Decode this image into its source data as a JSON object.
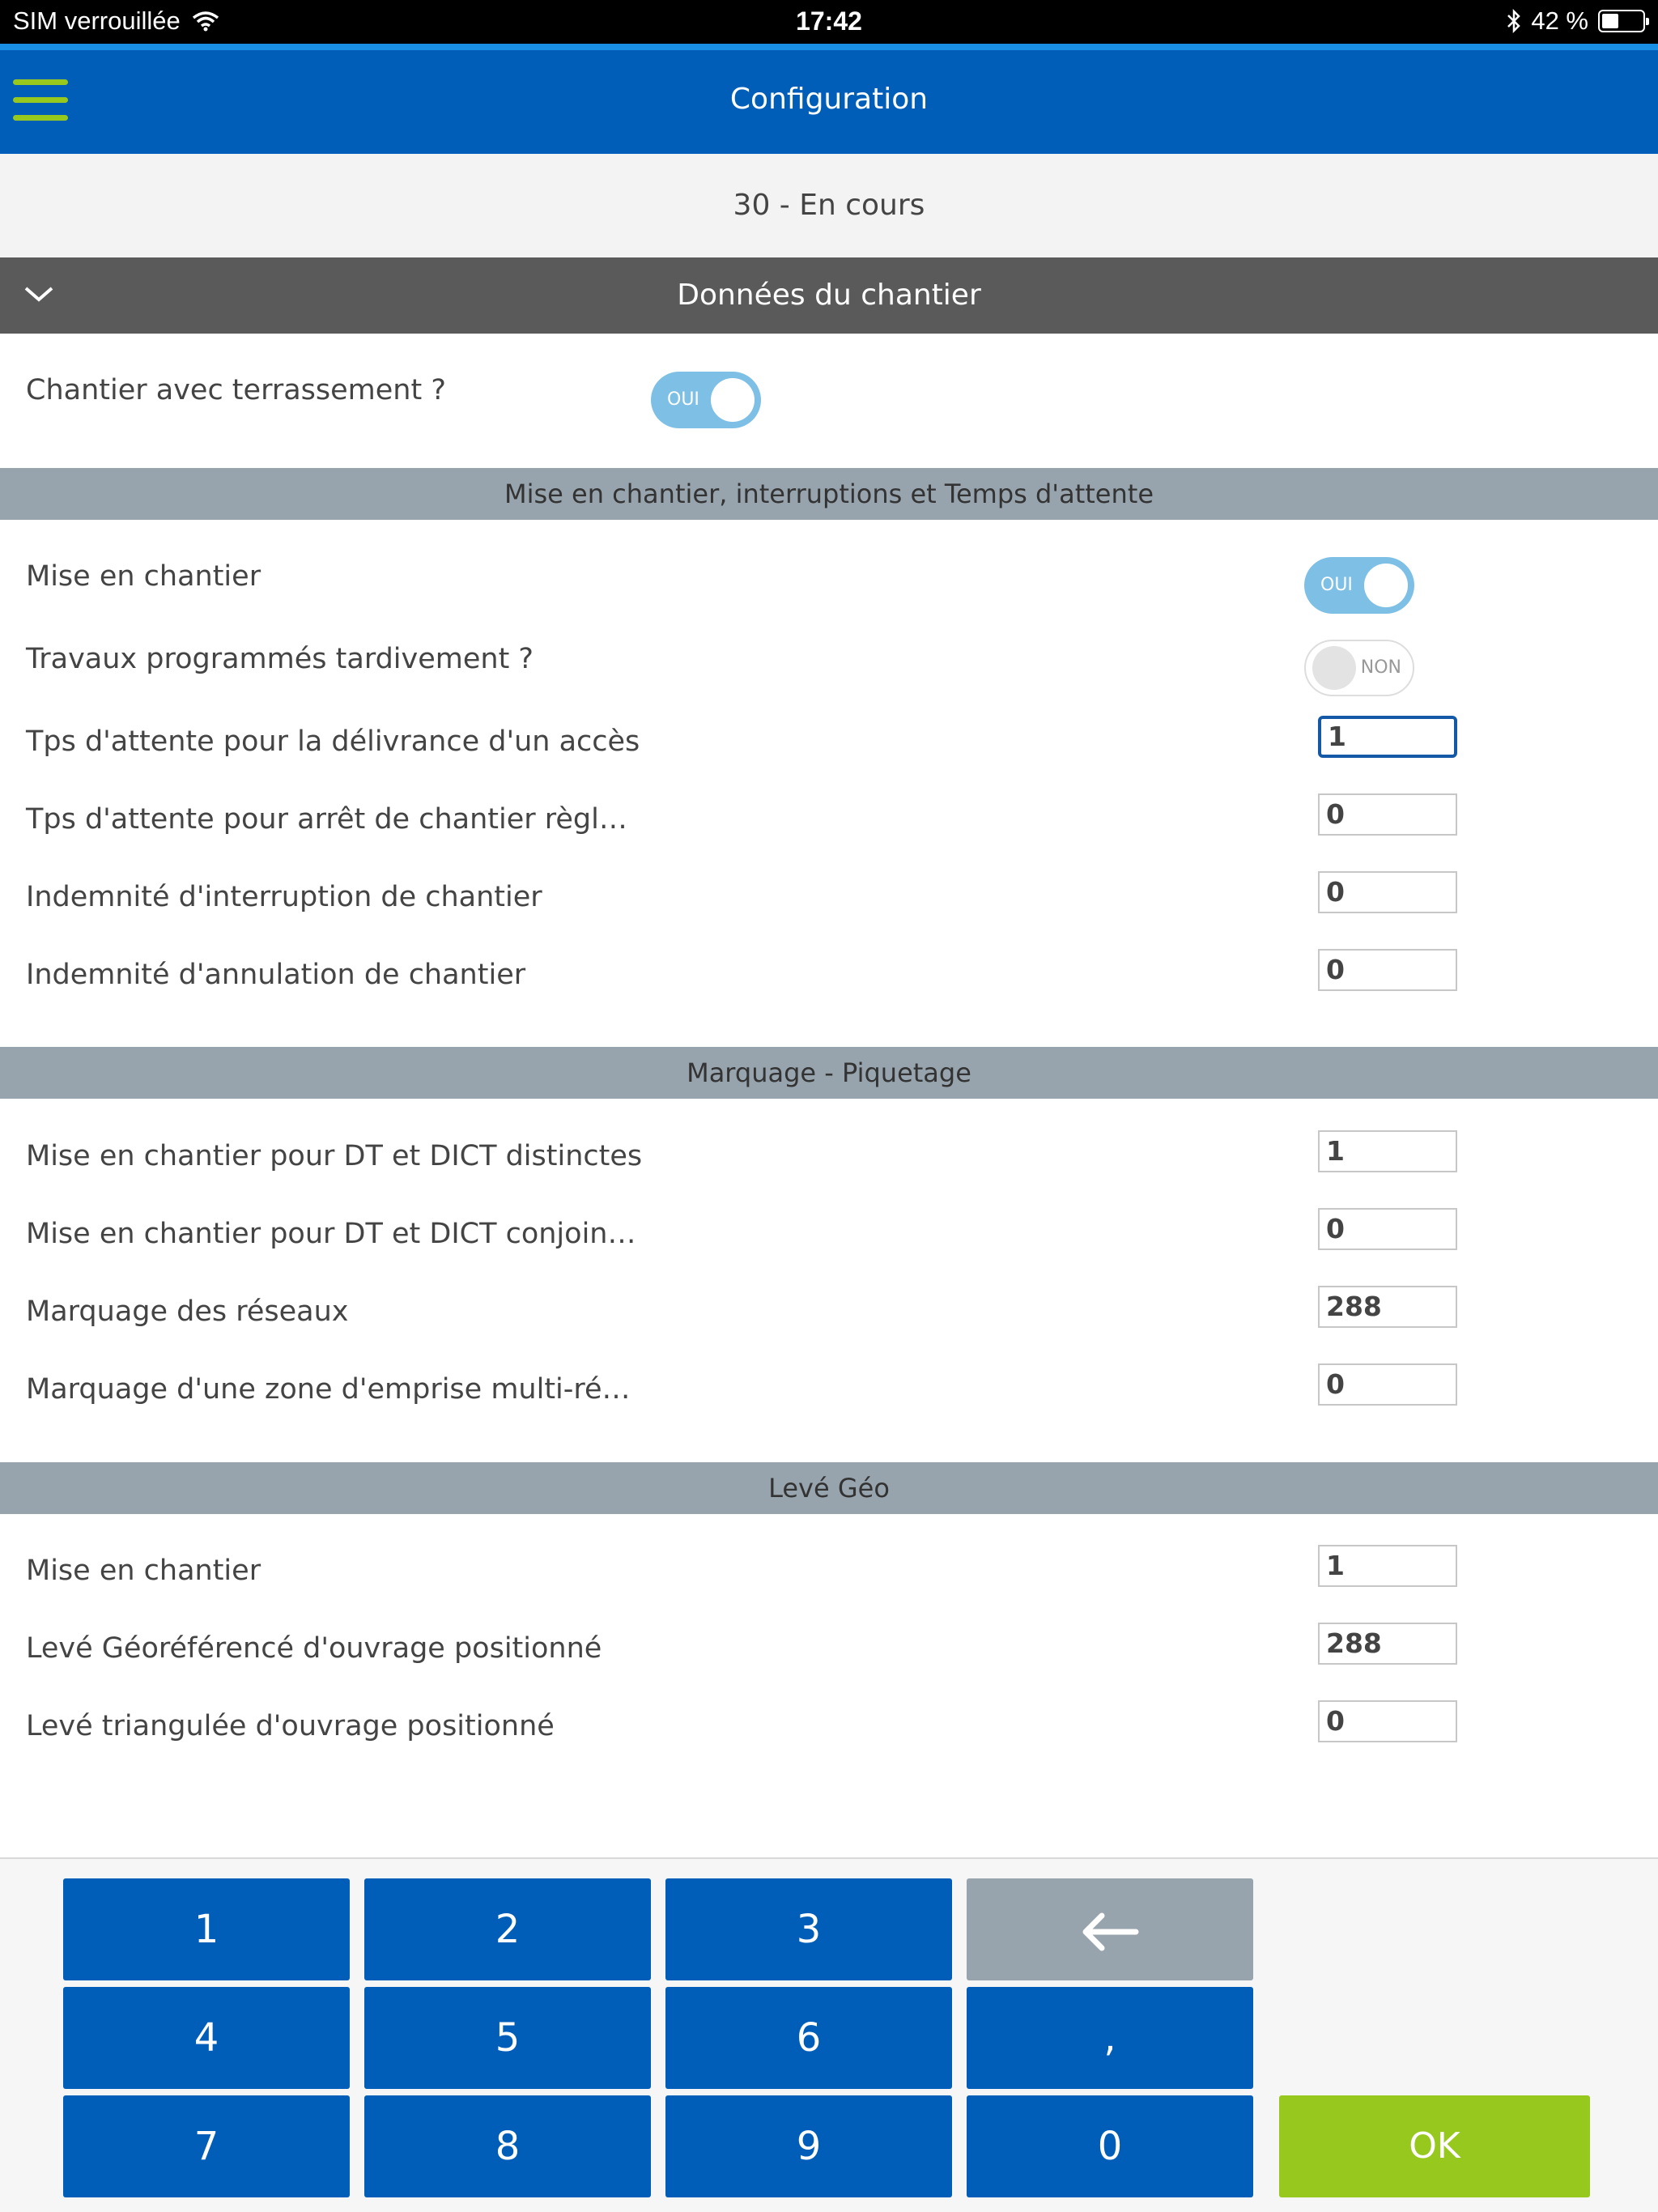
{
  "status_bar": {
    "carrier": "SIM verrouillée",
    "time": "17:42",
    "battery_text": "42 %",
    "battery_level": 0.42
  },
  "nav": {
    "title": "Configuration",
    "menu_icon": "hamburger-menu-icon"
  },
  "subheader": {
    "text": "30 -  En cours"
  },
  "section": {
    "title": "Données du chantier"
  },
  "terrassement": {
    "label": "Chantier avec terrassement ?",
    "toggle": "OUI",
    "on": true
  },
  "groups": {
    "mise": {
      "title": "Mise en chantier, interruptions et Temps d'attente",
      "toggles": [
        {
          "label": "Mise en chantier",
          "value": "OUI",
          "on": true
        },
        {
          "label": "Travaux programmés tardivement ?",
          "value": "NON",
          "on": false
        }
      ],
      "fields": [
        {
          "label": "Tps d'attente pour la délivrance d'un accès",
          "value": "1"
        },
        {
          "label": "Tps d'attente pour arrêt de chantier règl…",
          "value": "0"
        },
        {
          "label": "Indemnité d'interruption de chantier",
          "value": "0"
        },
        {
          "label": "Indemnité d'annulation de chantier",
          "value": "0"
        }
      ]
    },
    "marquage": {
      "title": "Marquage - Piquetage",
      "fields": [
        {
          "label": "Mise en chantier pour DT et DICT distinctes",
          "value": "1"
        },
        {
          "label": "Mise en chantier pour DT et DICT conjoin…",
          "value": "0"
        },
        {
          "label": "Marquage des réseaux",
          "value": "288"
        },
        {
          "label": "Marquage d'une zone d'emprise multi-ré…",
          "value": "0"
        }
      ]
    },
    "leve": {
      "title": "Levé Géo",
      "fields": [
        {
          "label": "Mise en chantier",
          "value": "1"
        },
        {
          "label": "Levé Géoréférencé d'ouvrage positionné",
          "value": "288"
        },
        {
          "label": "Levé triangulée d'ouvrage positionné",
          "value": "0"
        }
      ]
    }
  },
  "keypad": {
    "keys": [
      "1",
      "2",
      "3",
      "4",
      "5",
      "6",
      ",",
      "7",
      "8",
      "9",
      "0"
    ],
    "ok": "OK"
  }
}
